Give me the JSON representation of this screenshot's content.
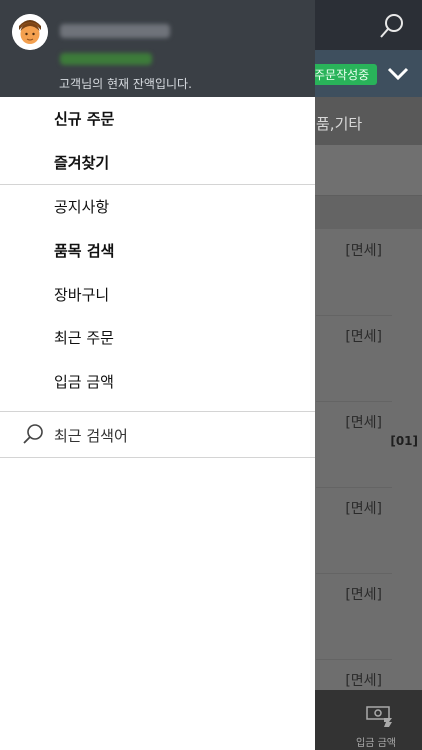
{
  "background": {
    "badge": "주문작성중",
    "category_label": "품,기타",
    "duty_labels": [
      "[면세]",
      "[면세]",
      "[면세]",
      "[면세]",
      "[면세]",
      "[면세]"
    ],
    "code_label": "[01]",
    "bottom_label": "입금 금액"
  },
  "drawer": {
    "header": {
      "user_name": "",
      "balance": "",
      "note": "고객님의 현재 잔액입니다."
    },
    "primary_menu": [
      {
        "label": "신규 주문"
      },
      {
        "label": "즐겨찾기"
      }
    ],
    "secondary_menu": [
      {
        "label": "공지사항"
      },
      {
        "label": "품목 검색"
      },
      {
        "label": "장바구니"
      },
      {
        "label": "최근 주문"
      },
      {
        "label": "입금 금액"
      }
    ],
    "recent_search_label": "최근 검색어"
  }
}
